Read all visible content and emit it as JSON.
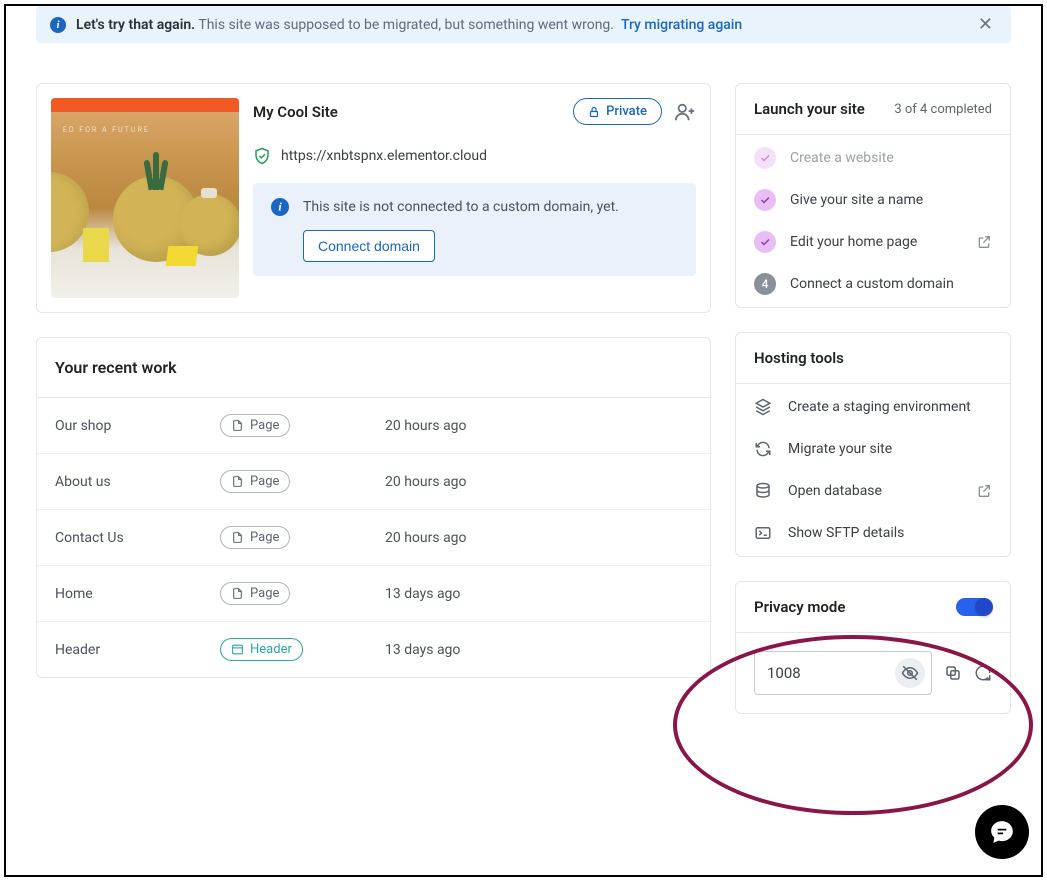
{
  "alert": {
    "bold": "Let's try that again.",
    "text": "This site was supposed to be migrated, but something went wrong.",
    "link": "Try migrating again"
  },
  "site": {
    "title": "My Cool Site",
    "private_label": "Private",
    "url": "https://xnbtspnx.elementor.cloud",
    "notice": "This site is not connected to a custom domain, yet.",
    "connect_btn": "Connect domain",
    "thumb_text": "ED FOR A FUTURE"
  },
  "recent": {
    "title": "Your recent work",
    "page_label": "Page",
    "header_label": "Header",
    "items": [
      {
        "name": "Our shop",
        "type": "page",
        "time": "20 hours ago"
      },
      {
        "name": "About us",
        "type": "page",
        "time": "20 hours ago"
      },
      {
        "name": "Contact Us",
        "type": "page",
        "time": "20 hours ago"
      },
      {
        "name": "Home",
        "type": "page",
        "time": "13 days ago"
      },
      {
        "name": "Header",
        "type": "header",
        "time": "13 days ago"
      }
    ]
  },
  "launch": {
    "title": "Launch your site",
    "progress": "3 of 4 completed",
    "steps": [
      {
        "label": "Create a website"
      },
      {
        "label": "Give your site a name"
      },
      {
        "label": "Edit your home page"
      },
      {
        "label": "Connect a custom domain",
        "num": "4"
      }
    ]
  },
  "tools": {
    "title": "Hosting tools",
    "items": [
      {
        "label": "Create a staging environment"
      },
      {
        "label": "Migrate your site"
      },
      {
        "label": "Open database"
      },
      {
        "label": "Show SFTP details"
      }
    ]
  },
  "privacy": {
    "title": "Privacy mode",
    "pin": "1008"
  }
}
